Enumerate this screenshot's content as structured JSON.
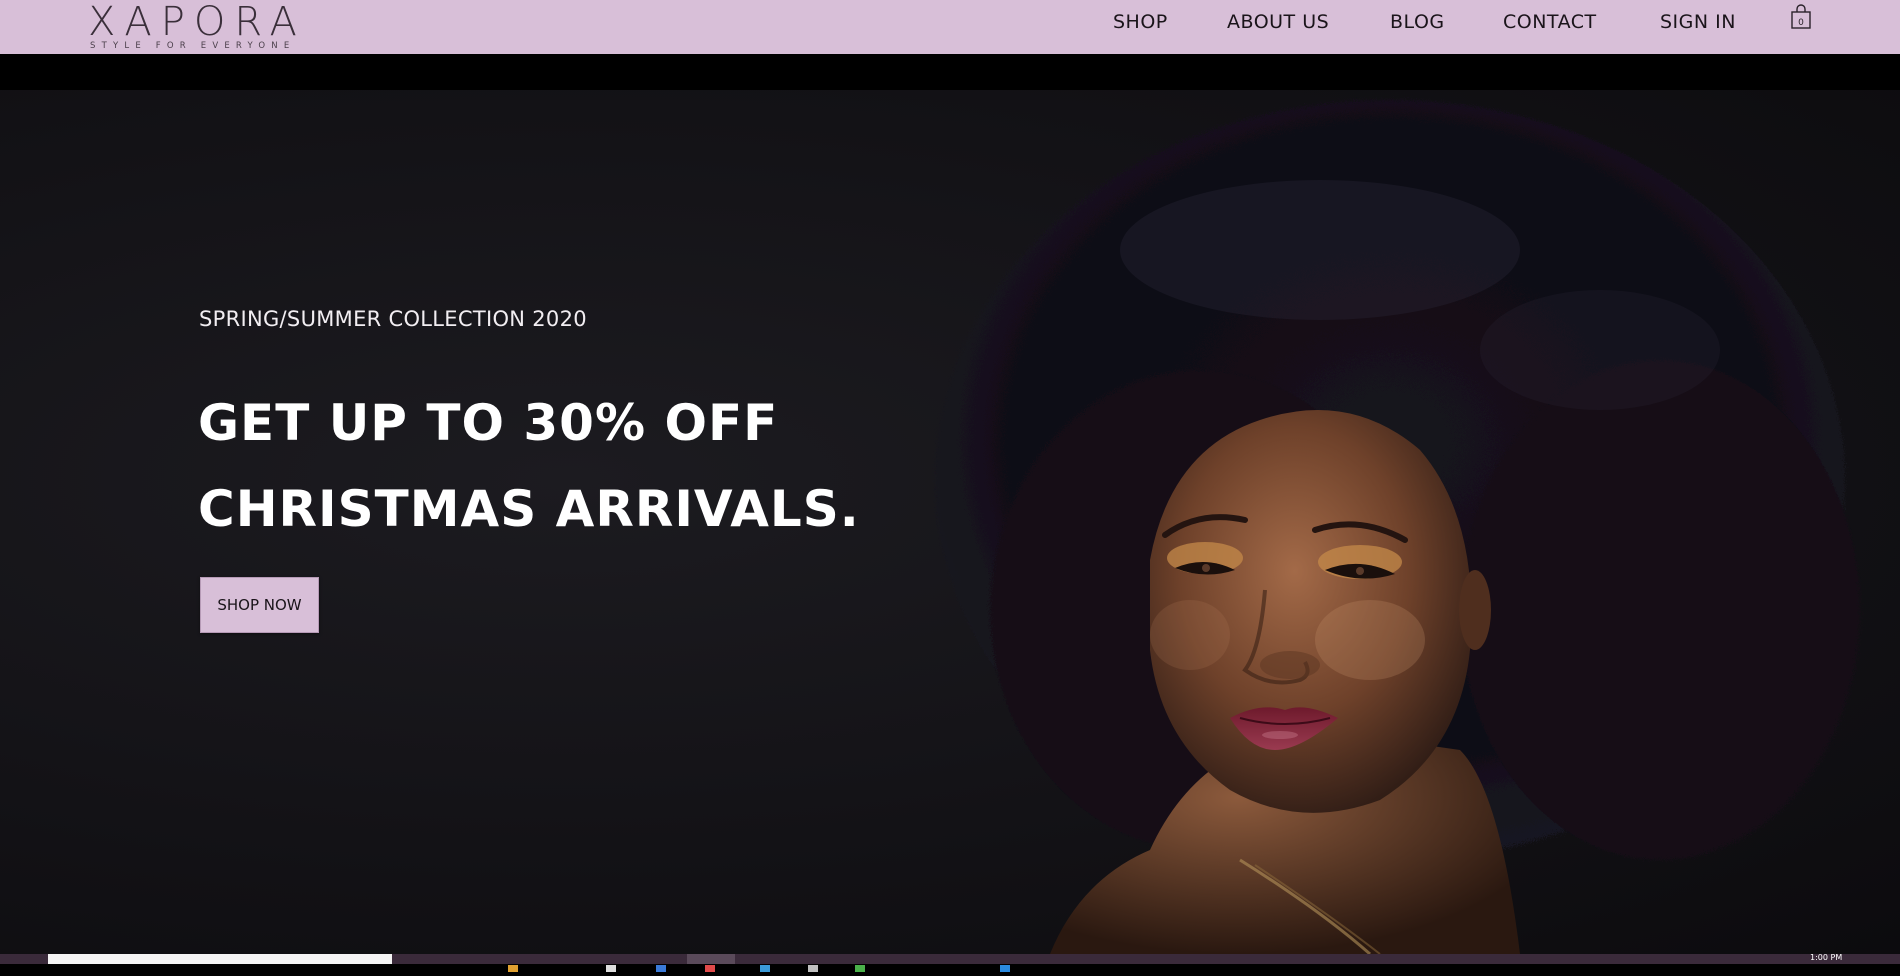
{
  "brand": {
    "name": "XAPORA",
    "tagline": "STYLE FOR EVERYONE"
  },
  "nav": {
    "items": [
      {
        "label": "SHOP"
      },
      {
        "label": "ABOUT US"
      },
      {
        "label": "BLOG"
      },
      {
        "label": "CONTACT"
      },
      {
        "label": "SIGN IN"
      }
    ],
    "cart_icon": "shopping-bag-icon",
    "cart_count": "0"
  },
  "hero": {
    "eyebrow": "SPRING/SUMMER COLLECTION 2020",
    "headline_line1": "GET UP TO 30% OFF",
    "headline_line2": "CHRISTMAS ARRIVALS.",
    "cta_label": "SHOP NOW"
  },
  "taskbar": {
    "clock": "1:00 PM"
  },
  "colors": {
    "nav_bg": "#d8bfd8",
    "button_bg": "#d8bfd8",
    "hero_bg": "#131216",
    "text_light": "#ffffff",
    "text_dark": "#1a141a"
  }
}
